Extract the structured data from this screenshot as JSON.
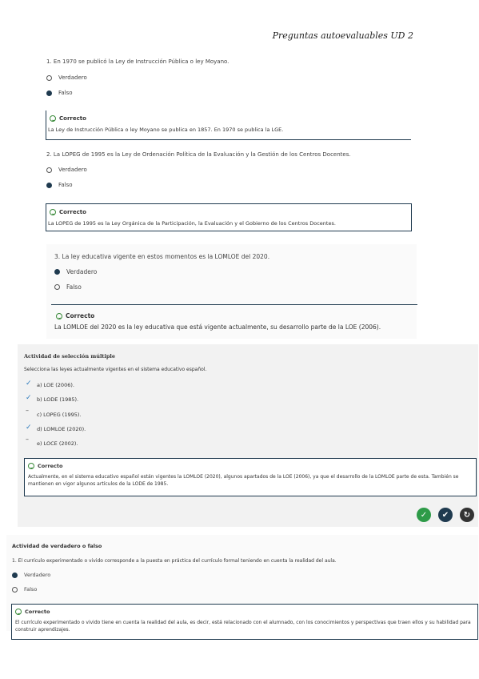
{
  "header": {
    "title": "Preguntas autoevaluables UD 2"
  },
  "q1": {
    "question": "1. En 1970 se publicó la Ley de Instrucción Pública o ley Moyano.",
    "options": [
      "Verdadero",
      "Falso"
    ],
    "selected": 1,
    "feedback_title": "Correcto",
    "feedback_text": "La Ley de Instrucción Pública o ley Moyano se publica en 1857. En 1970 se publica la LGE."
  },
  "q2": {
    "question": "2. La LOPEG de 1995 es la Ley de Ordenación Política de la Evaluación y la Gestión de los Centros Docentes.",
    "options": [
      "Verdadero",
      "Falso"
    ],
    "selected": 1,
    "feedback_title": "Correcto",
    "feedback_text": "La LOPEG de 1995 es la Ley Orgánica de la Participación, la Evaluación y el Gobierno de los Centros Docentes."
  },
  "q3": {
    "question": "3. La ley educativa vigente en estos momentos es la LOMLOE del 2020.",
    "options": [
      "Verdadero",
      "Falso"
    ],
    "selected": 0,
    "feedback_title": "Correcto",
    "feedback_text": "La LOMLOE del 2020 es la ley educativa que está vigente actualmente, su desarrollo parte de la LOE (2006)."
  },
  "multi": {
    "heading": "Actividad de selección múltiple",
    "instruction": "Selecciona las leyes actualmente vigentes en el sistema educativo español.",
    "options": [
      {
        "label": "a) LOE (2006).",
        "checked": true
      },
      {
        "label": "b) LODE (1985).",
        "checked": true
      },
      {
        "label": "c) LOPEG (1995).",
        "checked": false
      },
      {
        "label": "d) LOMLOE (2020).",
        "checked": true
      },
      {
        "label": "e) LOCE (2002).",
        "checked": false
      }
    ],
    "feedback_title": "Correcto",
    "feedback_text": "Actualmente, en el sistema educativo español están vigentes la LOMLOE (2020), algunos apartados de la LOE (2006), ya que el desarrollo de la LOMLOE parte de esta. También se mantienen en vigor algunos artículos de la LODE de 1985.",
    "buttons": [
      {
        "name": "check",
        "glyph": "✓",
        "color": "#2e9b48"
      },
      {
        "name": "solution",
        "glyph": "✔",
        "color": "#1f3a4f"
      },
      {
        "name": "retry",
        "glyph": "↻",
        "color": "#333333"
      }
    ]
  },
  "tf": {
    "heading": "Actividad de verdadero o falso",
    "question": "1. El currículo experimentado o vivido corresponde a la puesta en práctica del currículo formal teniendo en cuenta la realidad del aula.",
    "options": [
      "Verdadero",
      "Falso"
    ],
    "selected": 0,
    "feedback_title": "Correcto",
    "feedback_text": "El currículo experimentado o vivido tiene en cuenta la realidad del aula, es decir, está relacionado con el alumnado, con los conocimientos y perspectivas que traen ellos y su habilidad para construir aprendizajes."
  }
}
